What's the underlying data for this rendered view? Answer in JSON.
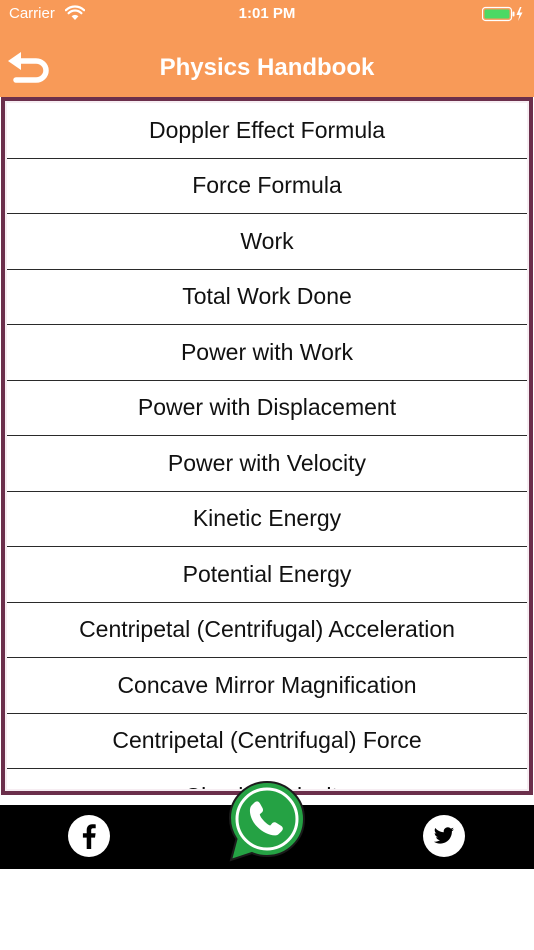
{
  "status_bar": {
    "carrier": "Carrier",
    "time": "1:01 PM"
  },
  "header": {
    "title": "Physics Handbook",
    "background_color": "#f89a58"
  },
  "list": {
    "items": [
      "Doppler Effect Formula",
      "Force Formula",
      "Work",
      "Total Work Done",
      "Power with Work",
      "Power with Displacement",
      "Power with Velocity",
      "Kinetic Energy",
      "Potential Energy",
      "Centripetal (Centrifugal) Acceleration",
      "Concave Mirror Magnification",
      "Centripetal (Centrifugal) Force",
      "Circular Velocity"
    ],
    "frame_color": "#6b2f4b"
  },
  "footer": {
    "icons": [
      "facebook-icon",
      "whatsapp-icon",
      "twitter-icon"
    ],
    "whatsapp_color": "#25a244"
  }
}
